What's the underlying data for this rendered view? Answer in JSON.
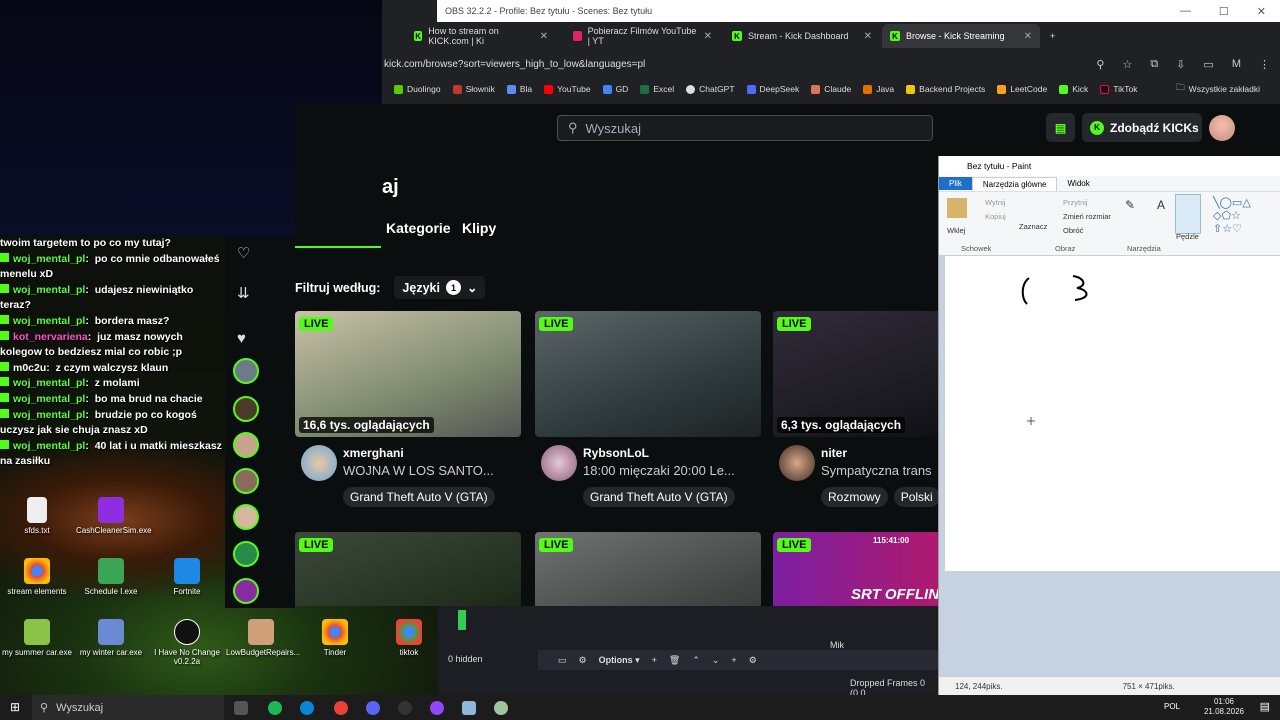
{
  "obs": {
    "window_title": "OBS 32.2.2 - Profile: Bez tytułu - Scenes: Bez tytułu",
    "hidden_label": "0 hidden",
    "options_label": "Options",
    "mic_label": "Mik",
    "dropped_frames": "Dropped Frames 0 (0.0"
  },
  "browser": {
    "tabs": [
      {
        "label": "How to stream on KICK.com | Ki"
      },
      {
        "label": "Pobieracz Filmów YouTube | YT"
      },
      {
        "label": "Stream - Kick Dashboard"
      },
      {
        "label": "Browse - Kick Streaming"
      }
    ],
    "url": "kick.com/browse?sort=viewers_high_to_low&languages=pl",
    "bookmarks": [
      "Duolingo",
      "Słownik",
      "Bla",
      "YouTube",
      "GD",
      "Excel",
      "ChatGPT",
      "DeepSeek",
      "Claude",
      "Java",
      "Backend Projects",
      "LeetCode",
      "Kick",
      "TikTok"
    ],
    "bookmarks_all": "Wszystkie zakładki"
  },
  "kick": {
    "search_placeholder": "Wyszukaj",
    "kicks_button": "Zdobądź KICKs",
    "page_title_fragment": "aj",
    "nav_tabs": [
      "Kategorie",
      "Klipy"
    ],
    "filter_label": "Filtruj według:",
    "language_button": "Języki",
    "language_count": "1",
    "live_label": "LIVE",
    "streams": [
      {
        "viewers": "16,6 tys. oglądających",
        "channel": "xmerghani",
        "title": "WOJNA W LOS SANTO...",
        "tags": [
          "Grand Theft Auto V (GTA)"
        ]
      },
      {
        "viewers": "",
        "channel": "RybsonLoL",
        "title": "18:00 mięczaki 20:00 Le...",
        "tags": [
          "Grand Theft Auto V (GTA)"
        ]
      },
      {
        "viewers": "6,3 tys. oglądających",
        "channel": "niter",
        "title": "Sympatyczna trans",
        "tags": [
          "Rozmowy",
          "Polski"
        ]
      }
    ],
    "second_row_overlay": "SRT OFFLINE",
    "second_row_time": "115:41:00"
  },
  "chat": {
    "messages": [
      {
        "user": "",
        "text": "twoim targetem to po co my tutaj?"
      },
      {
        "user": "woj_mental_pl",
        "text": "po co mnie odbanowałeś menelu xD"
      },
      {
        "user": "woj_mental_pl",
        "text": "udajesz niewiniątko teraz?"
      },
      {
        "user": "woj_mental_pl",
        "text": "bordera masz?"
      },
      {
        "user": "kot_nervariena",
        "text": "juz masz nowych kolegow to bedziesz mial co robic ;p"
      },
      {
        "user": "m0c2u",
        "text": "z czym walczysz klaun"
      },
      {
        "user": "woj_mental_pl",
        "text": "z molami"
      },
      {
        "user": "woj_mental_pl",
        "text": "bo ma brud na chacie"
      },
      {
        "user": "woj_mental_pl",
        "text": "brudzie po co kogoś uczysz jak sie chuja znasz xD"
      },
      {
        "user": "woj_mental_pl",
        "text": "40 lat i u matki mieszkasz na zasiłku"
      }
    ]
  },
  "desktop_icons": [
    {
      "label": "sfds.txt"
    },
    {
      "label": "CashCleanerSim.exe"
    },
    {
      "label": "stream elements"
    },
    {
      "label": "Schedule I.exe"
    },
    {
      "label": "Fortnite"
    },
    {
      "label": "my summer car.exe"
    },
    {
      "label": "my winter car.exe"
    },
    {
      "label": "I Have No Change v0.2.2a"
    },
    {
      "label": "LowBudgetRepairs..."
    },
    {
      "label": "Tinder"
    },
    {
      "label": "tiktok"
    }
  ],
  "paint": {
    "title": "Bez tytułu - Paint",
    "tabs": [
      "Plik",
      "Narzędzia główne",
      "Widok"
    ],
    "paste": "Wklej",
    "cut": "Wytnij",
    "copy": "Kopiuj",
    "select": "Zaznacz",
    "crop": "Przytnij",
    "resize": "Zmień rozmiar",
    "rotate": "Obróć",
    "brushes": "Pędzle",
    "group_clipboard": "Schowek",
    "group_image": "Obraz",
    "group_tools": "Narzędzia",
    "cursor_pos": "124, 244piks.",
    "canvas_size": "751 × 471piks."
  },
  "taskbar": {
    "search": "Wyszukaj",
    "lang": "POL",
    "time": "01:06",
    "date": "21.08.2026"
  },
  "colors": {
    "kick_green": "#53fc18",
    "paint_blue": "#1e6fc9"
  }
}
